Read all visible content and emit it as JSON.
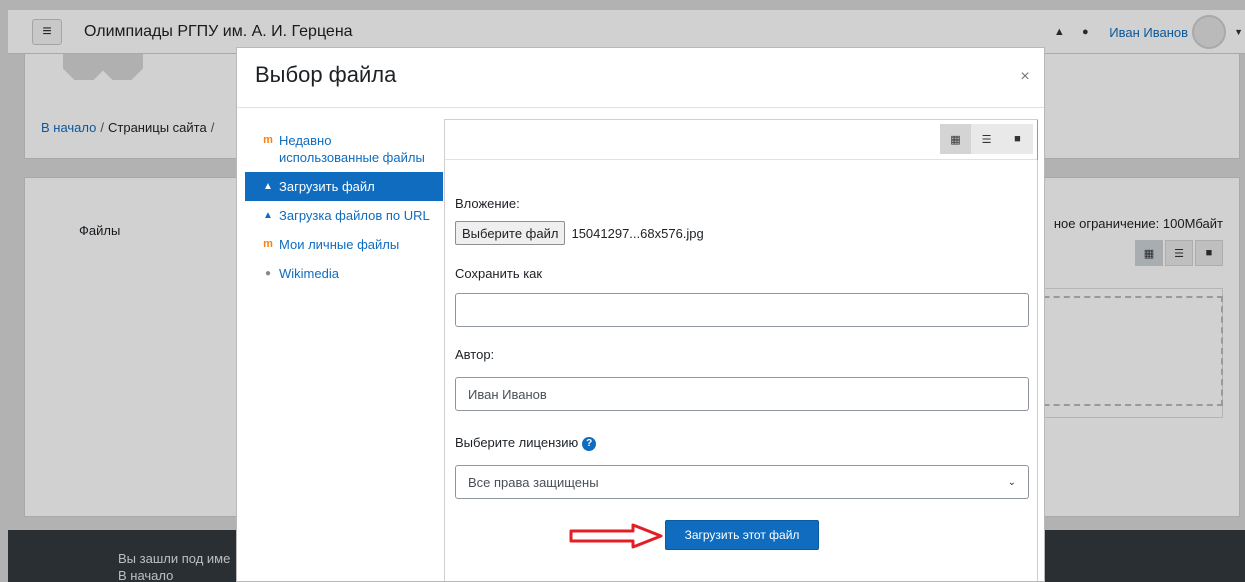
{
  "navbar": {
    "site_name": "Олимпиады РГПУ им. А. И. Герцена",
    "user_name": "Иван Иванов"
  },
  "breadcrumb": {
    "home": "В начало",
    "separator": "/",
    "pages": "Страницы сайта",
    "trailing_separator": "/"
  },
  "background": {
    "files_label": "Файлы",
    "limit_text": "ное ограничение: 100Мбайт"
  },
  "footer": {
    "logged_in_text": "Вы зашли под име",
    "home_link": "В начало"
  },
  "modal": {
    "title": "Выбор файла",
    "close_label": "×",
    "sidebar": [
      {
        "label": "Недавно использованные файлы",
        "icon": "moodle-icon",
        "active": false
      },
      {
        "label": "Загрузить файл",
        "icon": "upload-icon",
        "active": true
      },
      {
        "label": "Загрузка файлов по URL",
        "icon": "url-download-icon",
        "active": false
      },
      {
        "label": "Мои личные файлы",
        "icon": "moodle-icon",
        "active": false
      },
      {
        "label": "Wikimedia",
        "icon": "wikimedia-icon",
        "active": false
      }
    ],
    "form": {
      "attachment_label": "Вложение:",
      "choose_file_button": "Выберите файл",
      "chosen_file_name": "15041297...68x576.jpg",
      "save_as_label": "Сохранить как",
      "save_as_value": "",
      "author_label": "Автор:",
      "author_value": "Иван Иванов",
      "license_label": "Выберите лицензию",
      "license_value": "Все права защищены",
      "submit_button": "Загрузить этот файл"
    }
  },
  "colors": {
    "accent": "#0f6cbf",
    "annotation_arrow": "#e31e24",
    "footer_bg": "#343a40"
  }
}
